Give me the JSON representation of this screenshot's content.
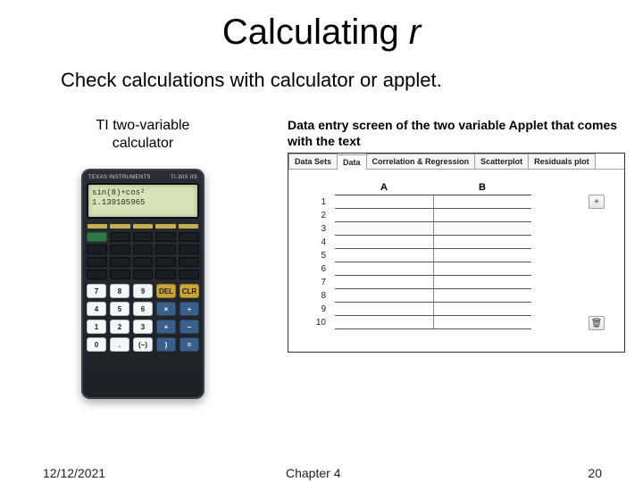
{
  "title_main": "Calculating ",
  "title_var": "r",
  "subtitle": "Check calculations with calculator or applet.",
  "left_caption_l1": "TI two-variable",
  "left_caption_l2": "calculator",
  "calc": {
    "brand_left": "TEXAS INSTRUMENTS",
    "brand_right": "TI-30X IIS",
    "screen_l1": "sin(8)+cos²",
    "screen_l2": "1.139105965",
    "buttons": {
      "row1": [
        "7",
        "8",
        "9",
        "DEL",
        "CLR"
      ],
      "row2": [
        "4",
        "5",
        "6",
        "×",
        "÷"
      ],
      "row3": [
        "1",
        "2",
        "3",
        "+",
        "−"
      ],
      "row4": [
        "0",
        ".",
        "(−)",
        ")",
        "="
      ]
    }
  },
  "right_caption": "Data entry screen of the two variable Applet that comes with the text",
  "applet": {
    "tabs": [
      "Data Sets",
      "Data",
      "Correlation & Regression",
      "Scatterplot",
      "Residuals plot"
    ],
    "active_tab": 1,
    "col_a": "A",
    "col_b": "B",
    "rows": [
      "1",
      "2",
      "3",
      "4",
      "5",
      "6",
      "7",
      "8",
      "9",
      "10"
    ],
    "icon_add": "+",
    "icon_trash": "🗑"
  },
  "footer": {
    "date": "12/12/2021",
    "chapter": "Chapter 4",
    "page": "20"
  }
}
